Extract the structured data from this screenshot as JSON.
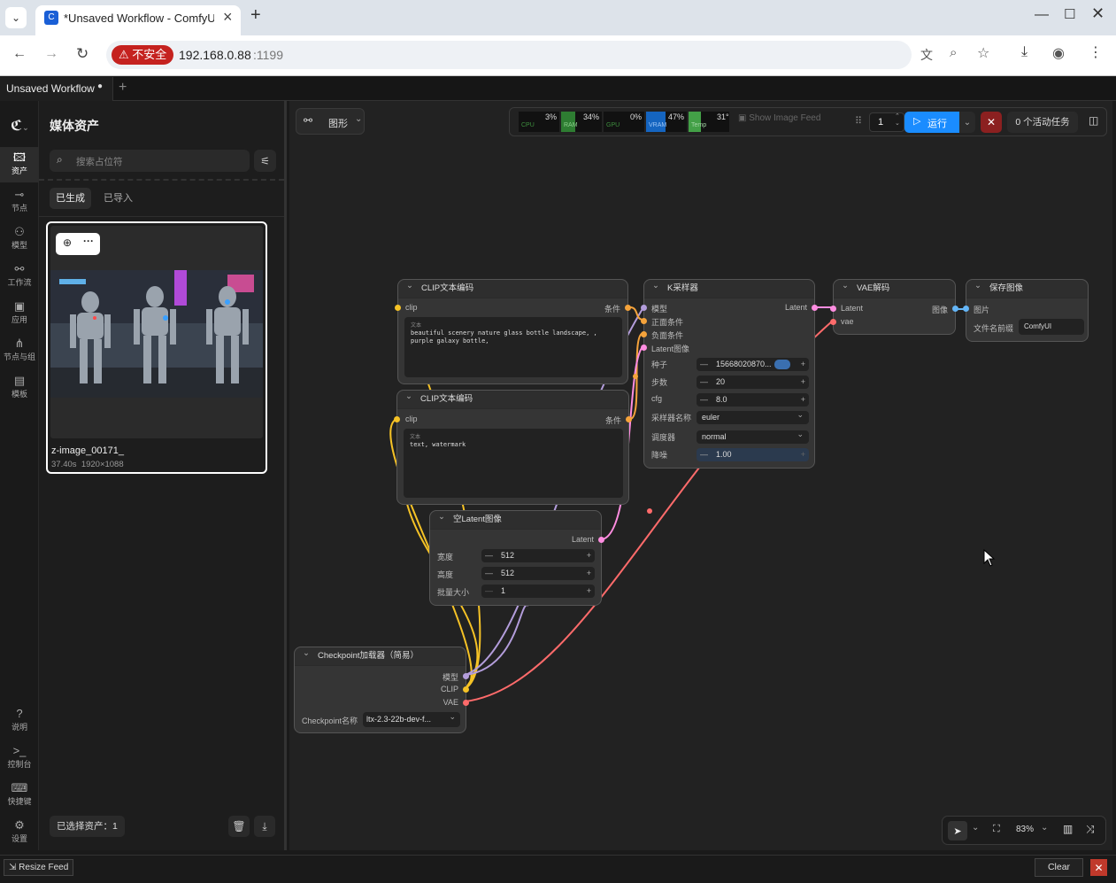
{
  "browser": {
    "tab_title": "*Unsaved Workflow - ComfyUI",
    "insecure_label": "不安全",
    "url_host": "192.168.0.88",
    "url_port": ":1199"
  },
  "app": {
    "workflow_tab": "Unsaved Workflow",
    "rail": [
      "资产",
      "节点",
      "模型",
      "工作流",
      "应用",
      "节点与组",
      "模板",
      "说明",
      "控制台",
      "快捷键",
      "设置"
    ]
  },
  "assets": {
    "title": "媒体资产",
    "search_placeholder": "搜索占位符",
    "tab_generated": "已生成",
    "tab_imported": "已导入",
    "item_name": "z-image_00171_",
    "item_time": "37.40s",
    "item_size": "1920×1088",
    "selected_count": "已选择资产：1"
  },
  "toolbar": {
    "graph_label": "图形",
    "cpu_label": "CPU",
    "cpu_value": "3%",
    "ram_label": "RAM",
    "ram_value": "34%",
    "gpu_label": "GPU",
    "gpu_value": "0%",
    "vram_label": "VRAM",
    "vram_value": "47%",
    "temp_label": "Temp",
    "temp_value": "31°",
    "show_feed": "Show Image Feed",
    "batch_count": "1",
    "run_label": "运行",
    "active_tasks": "0 个活动任务",
    "zoom": "83%"
  },
  "nodes": {
    "clip1": {
      "title": "CLIP文本编码",
      "in": "clip",
      "out": "条件",
      "field": "文本",
      "text": "beautiful scenery nature glass bottle landscape, , purple galaxy bottle,"
    },
    "clip2": {
      "title": "CLIP文本编码",
      "in": "clip",
      "out": "条件",
      "field": "文本",
      "text": "text, watermark"
    },
    "ksampler": {
      "title": "K采样器",
      "in_model": "模型",
      "in_pos": "正面条件",
      "in_neg": "负面条件",
      "in_latent": "Latent图像",
      "out": "Latent",
      "seed_label": "种子",
      "seed": "15668020870...",
      "steps_label": "步数",
      "steps": "20",
      "cfg_label": "cfg",
      "cfg": "8.0",
      "sampler_label": "采样器名称",
      "sampler": "euler",
      "scheduler_label": "调度器",
      "scheduler": "normal",
      "denoise_label": "降噪",
      "denoise": "1.00"
    },
    "vae": {
      "title": "VAE解码",
      "in_latent": "Latent",
      "in_vae": "vae",
      "out": "图像"
    },
    "save": {
      "title": "保存图像",
      "in": "图片",
      "prefix_label": "文件名前缀",
      "prefix": "ComfyUI"
    },
    "latent": {
      "title": "空Latent图像",
      "out": "Latent",
      "w_label": "宽度",
      "w": "512",
      "h_label": "高度",
      "h": "512",
      "b_label": "批量大小",
      "b": "1"
    },
    "ckpt": {
      "title": "Checkpoint加载器（简易）",
      "out_model": "模型",
      "out_clip": "CLIP",
      "out_vae": "VAE",
      "name_label": "Checkpoint名称",
      "name": "ltx-2.3-22b-dev-f..."
    }
  },
  "status": {
    "resize_feed": "Resize Feed",
    "clear": "Clear"
  },
  "colors": {
    "clip": "#f5c226",
    "model": "#b39ddb",
    "cond": "#f5a33b",
    "latent": "#ff8de0",
    "vae": "#ff6b6b",
    "image": "#64b5f6",
    "run": "#1a8cff"
  }
}
